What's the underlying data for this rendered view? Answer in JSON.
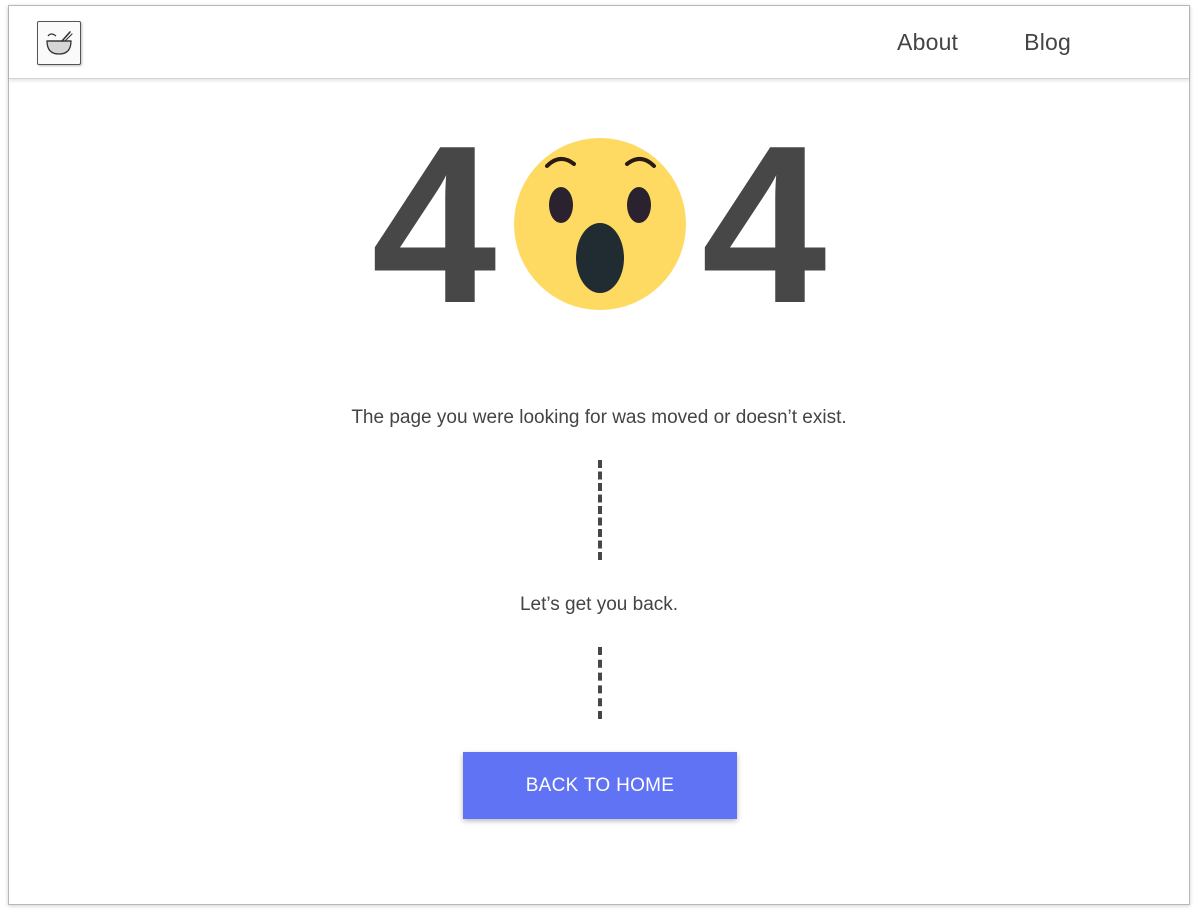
{
  "nav": {
    "logo_icon": "mortar-pestle-icon",
    "links": [
      {
        "label": "About"
      },
      {
        "label": "Blog"
      }
    ]
  },
  "hero": {
    "digit_left": "4",
    "digit_right": "4",
    "emoji_icon": "surprised-face-icon",
    "emoji_color": "#FFDA62"
  },
  "content": {
    "message": "The page you were looking for was moved or doesn’t exist.",
    "submessage": "Let’s get you back.",
    "button_label": "BACK TO HOME"
  },
  "colors": {
    "button_bg": "#6173F5",
    "text": "#444444",
    "digits": "#474747"
  }
}
